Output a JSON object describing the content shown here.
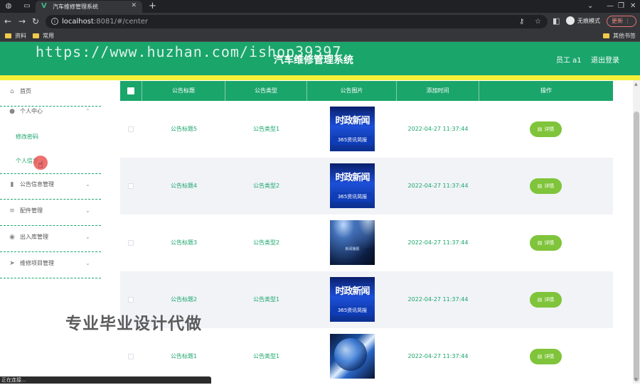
{
  "browser": {
    "tab_title": "汽车维修管理系统",
    "url_host": "localhost",
    "url_path": ":8081/#/center",
    "profile_label": "无痕模式",
    "update_label": "更新",
    "bookmarks": [
      "资料",
      "常用"
    ],
    "other_bookmarks": "其他书签",
    "status_text": "正在连接..."
  },
  "header": {
    "title": "汽车维修管理系统",
    "user": "员工 a1",
    "logout": "退出登录",
    "watermark_url": "https://www.huzhan.com/ishop39397"
  },
  "sidebar": {
    "items": [
      {
        "label": "首页",
        "icon": "home-icon"
      },
      {
        "label": "个人中心",
        "icon": "person-icon",
        "expanded": true
      },
      {
        "label": "公告信息管理",
        "icon": "chart-icon"
      },
      {
        "label": "配件管理",
        "icon": "sliders-icon"
      },
      {
        "label": "出入库管理",
        "icon": "location-icon"
      },
      {
        "label": "维修项目管理",
        "icon": "send-icon"
      }
    ],
    "sub_items": [
      "修改密码",
      "个人信息"
    ]
  },
  "table": {
    "headers": [
      "公告标题",
      "公告类型",
      "公告图片",
      "添加时间",
      "操作"
    ],
    "detail_label": "详情",
    "rows": [
      {
        "title": "公告标题5",
        "type": "公告类型1",
        "image": "news",
        "time": "2022-04-27 11:37:44"
      },
      {
        "title": "公告标题4",
        "type": "公告类型2",
        "image": "news",
        "time": "2022-04-27 11:37:44"
      },
      {
        "title": "公告标题3",
        "type": "公告类型2",
        "image": "stage",
        "time": "2022-04-27 11:37:44"
      },
      {
        "title": "公告标题2",
        "type": "公告类型1",
        "image": "news",
        "time": "2022-04-27 11:37:44"
      },
      {
        "title": "公告标题1",
        "type": "公告类型1",
        "image": "abstract",
        "time": "2022-04-27 11:37:44"
      }
    ]
  },
  "thumb_text": {
    "news_main": "时政新闻",
    "news_sub": "365资讯简报",
    "stage_label": "新闻播报"
  },
  "overlay_watermark": "专业毕业设计代做",
  "colors": {
    "primary": "#1aa56b",
    "accent_strip": "#f5ef3a",
    "detail_button": "#7fc43a"
  }
}
